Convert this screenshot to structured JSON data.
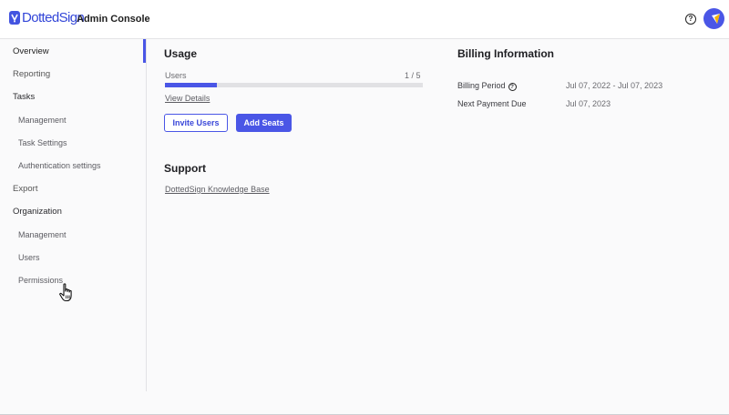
{
  "header": {
    "brand": "DottedSign",
    "app_title": "Admin Console",
    "help_icon": "question-circle-icon",
    "avatar_icon": "user-avatar-icon"
  },
  "colors": {
    "accent": "#4a56e6",
    "brand": "#3346d8"
  },
  "sidebar": {
    "items": [
      {
        "label": "Overview"
      },
      {
        "label": "Reporting"
      },
      {
        "label": "Tasks"
      },
      {
        "label": "Management"
      },
      {
        "label": "Task Settings"
      },
      {
        "label": "Authentication settings"
      },
      {
        "label": "Export"
      },
      {
        "label": "Organization"
      },
      {
        "label": "Management"
      },
      {
        "label": "Users"
      },
      {
        "label": "Permissions"
      }
    ]
  },
  "usage": {
    "title": "Usage",
    "users_label": "Users",
    "users_count": "1 / 5",
    "users_progress_fraction": 0.2,
    "view_details": "View Details",
    "invite_users": "Invite Users",
    "add_seats": "Add Seats"
  },
  "support": {
    "title": "Support",
    "kb_link": "DottedSign Knowledge Base"
  },
  "billing": {
    "title": "Billing Information",
    "period_label": "Billing Period",
    "period_value": "Jul 07, 2022 - Jul 07, 2023",
    "next_payment_label": "Next Payment Due",
    "next_payment_value": "Jul 07, 2023"
  }
}
